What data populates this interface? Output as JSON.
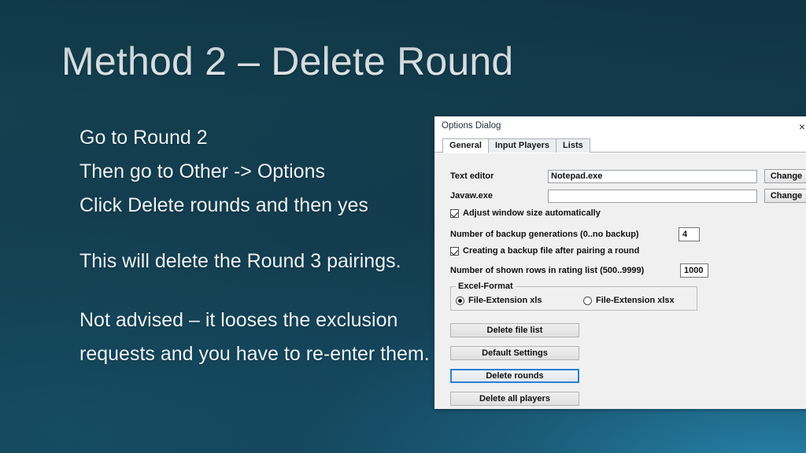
{
  "slide": {
    "title": "Method 2 – Delete Round",
    "body_lines": [
      "Go to Round 2",
      "Then go to Other -> Options",
      "Click Delete rounds and then yes",
      "This will delete the Round 3 pairings.",
      "Not advised – it looses the exclusion requests and you have to re-enter them."
    ],
    "background": {
      "top_left": "#14414f",
      "top_right": "#133a4d",
      "bottom_right": "#1d6d94",
      "text_color": "#edf2f5"
    }
  },
  "dialog": {
    "title": "Options Dialog",
    "close_label": "×",
    "tabs": [
      {
        "label": "General",
        "active": true
      },
      {
        "label": "Input Players",
        "active": false
      },
      {
        "label": "Lists",
        "active": false
      }
    ],
    "fields": {
      "text_editor_label": "Text editor",
      "text_editor_value": "Notepad.exe",
      "text_editor_button": "Change",
      "javaw_label": "Javaw.exe",
      "javaw_value": "",
      "javaw_button": "Change",
      "adjust_window_label": "Adjust window size automatically",
      "adjust_window_checked": true,
      "backup_generations_label": "Number of backup generations (0..no backup)",
      "backup_generations_value": "4",
      "creating_backup_label": "Creating a backup file after pairing a round",
      "creating_backup_checked": true,
      "shown_rows_label": "Number of shown rows in rating list (500..9999)",
      "shown_rows_value": "1000"
    },
    "excel_format": {
      "legend": "Excel-Format",
      "options": [
        {
          "label": "File-Extension xls",
          "selected": true
        },
        {
          "label": "File-Extension xlsx",
          "selected": false
        }
      ]
    },
    "action_buttons": [
      {
        "label": "Delete file list",
        "focused": false
      },
      {
        "label": "Default Settings",
        "focused": false
      },
      {
        "label": "Delete rounds",
        "focused": true
      },
      {
        "label": "Delete all players",
        "focused": false
      }
    ],
    "focus_color": "#2a7fd4"
  }
}
